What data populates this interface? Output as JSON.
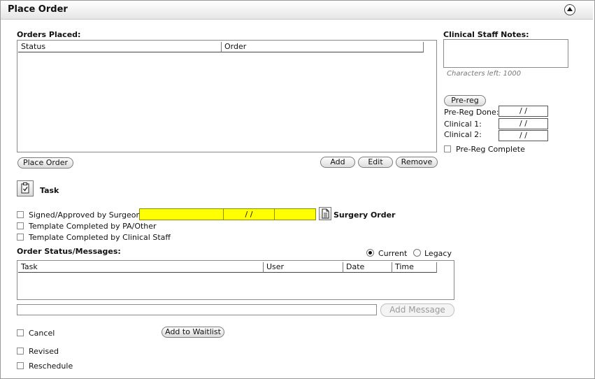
{
  "header": {
    "title": "Place Order"
  },
  "icons": {
    "collapse": "chevron-up-circle-icon",
    "task": "clipboard-check-icon",
    "document": "document-icon"
  },
  "orders": {
    "label": "Orders Placed:",
    "columns": [
      "Status",
      "Order"
    ],
    "place_order_label": "Place Order",
    "add_label": "Add",
    "edit_label": "Edit",
    "remove_label": "Remove"
  },
  "notes": {
    "label": "Clinical Staff Notes:",
    "chars_left": "Characters left: 1000"
  },
  "prereg": {
    "button_label": "Pre-reg",
    "done_label": "Pre-Reg Done:",
    "done_value": " /  /",
    "clinical1_label": "Clinical 1:",
    "clinical1_value": " /  /",
    "clinical2_label": "Clinical 2:",
    "clinical2_value": " /  /",
    "complete_label": "Pre-Reg Complete"
  },
  "task": {
    "label": "Task"
  },
  "surgeon": {
    "signed_label": "Signed/Approved by Surgeon:",
    "date_value": "/ /",
    "surgery_order_label": "Surgery Order",
    "template_pa_label": "Template Completed by PA/Other",
    "template_clinical_label": "Template Completed by Clinical Staff"
  },
  "messages": {
    "label": "Order Status/Messages:",
    "current_label": "Current",
    "legacy_label": "Legacy",
    "selected": "Current",
    "columns": [
      "Task",
      "User",
      "Date",
      "Time"
    ],
    "add_message_label": "Add Message"
  },
  "footer": {
    "cancel_label": "Cancel",
    "revised_label": "Revised",
    "reschedule_label": "Reschedule",
    "waitlist_label": "Add to Waitlist"
  }
}
